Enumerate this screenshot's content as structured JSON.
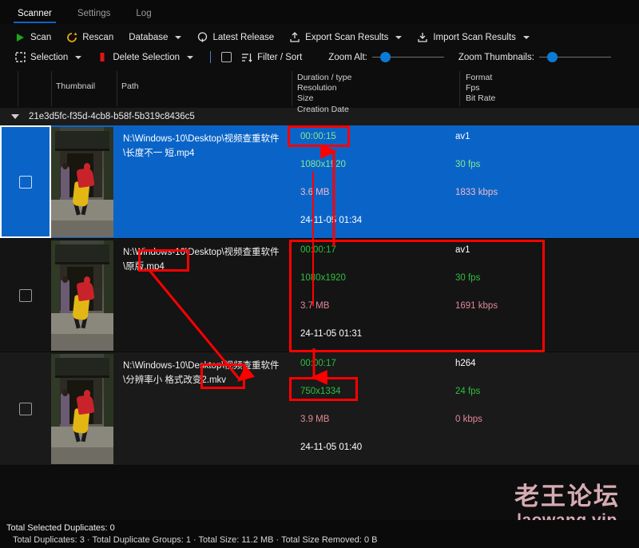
{
  "window": {
    "tabs": [
      {
        "label": "Scanner",
        "active": true
      },
      {
        "label": "Settings",
        "active": false
      },
      {
        "label": "Log",
        "active": false
      }
    ]
  },
  "toolbar": {
    "row1": [
      {
        "name": "scan-button",
        "icon": "play-icon",
        "label": "Scan",
        "caret": false
      },
      {
        "name": "rescan-button",
        "icon": "refresh-icon",
        "label": "Rescan",
        "caret": false
      },
      {
        "name": "database-button",
        "icon": "none",
        "label": "Database",
        "caret": true
      },
      {
        "name": "latest-release-button",
        "icon": "github-icon",
        "label": "Latest Release",
        "caret": false
      },
      {
        "name": "export-scan-results-button",
        "icon": "upload-icon",
        "label": "Export Scan Results",
        "caret": true
      },
      {
        "name": "import-scan-results-button",
        "icon": "download-icon",
        "label": "Import Scan Results",
        "caret": true
      }
    ],
    "row2": {
      "selection_label": "Selection",
      "delete_selection_label": "Delete Selection",
      "filter_sort_label": "Filter / Sort",
      "zoom_all_label": "Zoom Alt:",
      "zoom_thumbnails_label": "Zoom Thumbnails:"
    }
  },
  "columns": {
    "thumbnail": "Thumbnail",
    "path": "Path",
    "duration_type": "Duration / type",
    "resolution": "Resolution",
    "size": "Size",
    "creation_date": "Creation Date",
    "format": "Format",
    "fps": "Fps",
    "bit_rate": "Bit Rate"
  },
  "group": {
    "id": "21e3d5fc-f35d-4cb8-b58f-5b319c8436c5"
  },
  "rows": [
    {
      "selected": true,
      "checked": false,
      "path_line1": "N:\\Windows-10\\Desktop\\视频查重软件",
      "path_line2": "\\长度不一 短.mp4",
      "duration": "00:00:15",
      "format": "av1",
      "resolution": "1080x1920",
      "fps": "30 fps",
      "size": "3.6 MB",
      "bitrate": "1833 kbps",
      "date": "24-11-05 01:34"
    },
    {
      "selected": false,
      "checked": false,
      "path_line1": "N:\\Windows-10\\Desktop\\视频查重软件",
      "path_line2": "\\原版.mp4",
      "duration": "00:00:17",
      "format": "av1",
      "resolution": "1080x1920",
      "fps": "30 fps",
      "size": "3.7 MB",
      "bitrate": "1691 kbps",
      "date": "24-11-05 01:31"
    },
    {
      "selected": false,
      "checked": false,
      "path_line1": "N:\\Windows-10\\Desktop\\视频查重软件",
      "path_line2": "\\分辨率小 格式改变2.mkv",
      "duration": "00:00:17",
      "format": "h264",
      "resolution": "750x1334",
      "fps": "24 fps",
      "size": "3.9 MB",
      "bitrate": "0 kbps",
      "date": "24-11-05 01:40"
    }
  ],
  "annotation": {
    "color": "#ff0000"
  },
  "watermark": {
    "cn": "老王论坛",
    "en": "laowang.vip"
  },
  "status": {
    "line1": "Total Selected Duplicates: 0",
    "line2": "Total Duplicates: 3 · Total Duplicate Groups: 1 · Total Size: 11.2 MB · Total Size Removed: 0 B"
  }
}
